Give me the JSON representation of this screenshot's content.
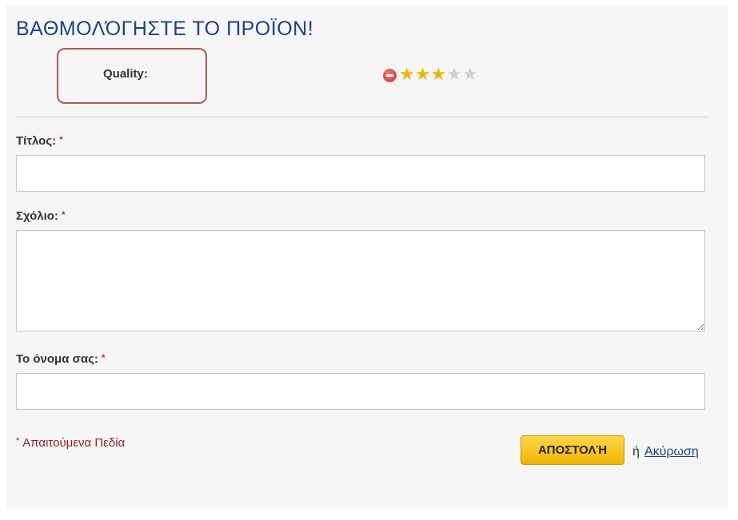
{
  "form": {
    "title": "ΒΑΘΜΟΛΌΓΗΣΤΕ ΤΟ ΠΡΟΪΟΝ!",
    "rating": {
      "label": "Quality:",
      "value": 3,
      "max": 5,
      "cancel_icon": "cancel-rating-icon",
      "star_color_on": "#f5b400",
      "star_color_off": "#d2d2d2"
    },
    "fields": {
      "title_label": "Τίτλος:",
      "title_value": "",
      "comment_label": "Σχόλιο:",
      "comment_value": "",
      "name_label": "Το όνομα σας:",
      "name_value": "",
      "required_mark": "*"
    },
    "required_note": "Απαιτούμενα Πεδία",
    "submit_label": "ΑΠΟΣΤΟΛΉ",
    "or_text": "ή",
    "cancel_label": "Ακύρωση"
  },
  "colors": {
    "title": "#1d3f8f",
    "highlight_border": "#b05a5a",
    "button": "#f5c518",
    "required": "#8c1f1f"
  }
}
